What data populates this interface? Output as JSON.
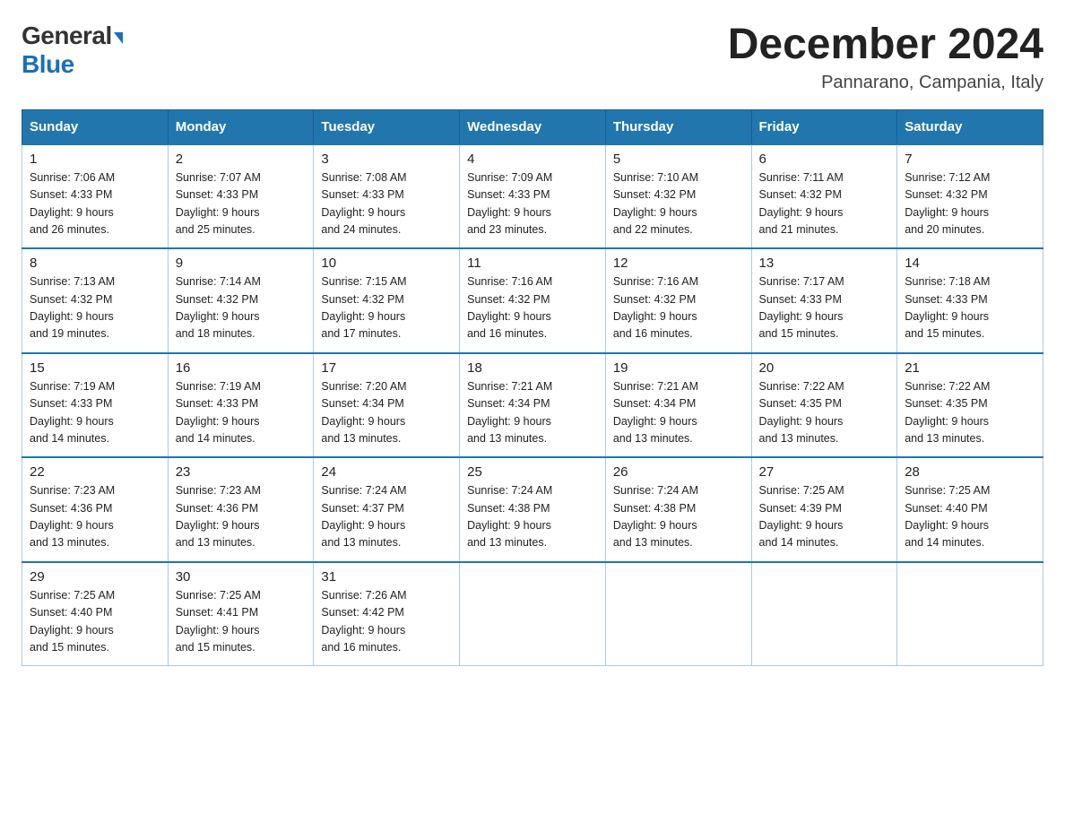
{
  "header": {
    "logo_general": "General",
    "logo_blue": "Blue",
    "month_title": "December 2024",
    "subtitle": "Pannarano, Campania, Italy"
  },
  "days_of_week": [
    "Sunday",
    "Monday",
    "Tuesday",
    "Wednesday",
    "Thursday",
    "Friday",
    "Saturday"
  ],
  "weeks": [
    [
      {
        "day": "1",
        "sunrise": "7:06 AM",
        "sunset": "4:33 PM",
        "daylight": "9 hours and 26 minutes."
      },
      {
        "day": "2",
        "sunrise": "7:07 AM",
        "sunset": "4:33 PM",
        "daylight": "9 hours and 25 minutes."
      },
      {
        "day": "3",
        "sunrise": "7:08 AM",
        "sunset": "4:33 PM",
        "daylight": "9 hours and 24 minutes."
      },
      {
        "day": "4",
        "sunrise": "7:09 AM",
        "sunset": "4:33 PM",
        "daylight": "9 hours and 23 minutes."
      },
      {
        "day": "5",
        "sunrise": "7:10 AM",
        "sunset": "4:32 PM",
        "daylight": "9 hours and 22 minutes."
      },
      {
        "day": "6",
        "sunrise": "7:11 AM",
        "sunset": "4:32 PM",
        "daylight": "9 hours and 21 minutes."
      },
      {
        "day": "7",
        "sunrise": "7:12 AM",
        "sunset": "4:32 PM",
        "daylight": "9 hours and 20 minutes."
      }
    ],
    [
      {
        "day": "8",
        "sunrise": "7:13 AM",
        "sunset": "4:32 PM",
        "daylight": "9 hours and 19 minutes."
      },
      {
        "day": "9",
        "sunrise": "7:14 AM",
        "sunset": "4:32 PM",
        "daylight": "9 hours and 18 minutes."
      },
      {
        "day": "10",
        "sunrise": "7:15 AM",
        "sunset": "4:32 PM",
        "daylight": "9 hours and 17 minutes."
      },
      {
        "day": "11",
        "sunrise": "7:16 AM",
        "sunset": "4:32 PM",
        "daylight": "9 hours and 16 minutes."
      },
      {
        "day": "12",
        "sunrise": "7:16 AM",
        "sunset": "4:32 PM",
        "daylight": "9 hours and 16 minutes."
      },
      {
        "day": "13",
        "sunrise": "7:17 AM",
        "sunset": "4:33 PM",
        "daylight": "9 hours and 15 minutes."
      },
      {
        "day": "14",
        "sunrise": "7:18 AM",
        "sunset": "4:33 PM",
        "daylight": "9 hours and 15 minutes."
      }
    ],
    [
      {
        "day": "15",
        "sunrise": "7:19 AM",
        "sunset": "4:33 PM",
        "daylight": "9 hours and 14 minutes."
      },
      {
        "day": "16",
        "sunrise": "7:19 AM",
        "sunset": "4:33 PM",
        "daylight": "9 hours and 14 minutes."
      },
      {
        "day": "17",
        "sunrise": "7:20 AM",
        "sunset": "4:34 PM",
        "daylight": "9 hours and 13 minutes."
      },
      {
        "day": "18",
        "sunrise": "7:21 AM",
        "sunset": "4:34 PM",
        "daylight": "9 hours and 13 minutes."
      },
      {
        "day": "19",
        "sunrise": "7:21 AM",
        "sunset": "4:34 PM",
        "daylight": "9 hours and 13 minutes."
      },
      {
        "day": "20",
        "sunrise": "7:22 AM",
        "sunset": "4:35 PM",
        "daylight": "9 hours and 13 minutes."
      },
      {
        "day": "21",
        "sunrise": "7:22 AM",
        "sunset": "4:35 PM",
        "daylight": "9 hours and 13 minutes."
      }
    ],
    [
      {
        "day": "22",
        "sunrise": "7:23 AM",
        "sunset": "4:36 PM",
        "daylight": "9 hours and 13 minutes."
      },
      {
        "day": "23",
        "sunrise": "7:23 AM",
        "sunset": "4:36 PM",
        "daylight": "9 hours and 13 minutes."
      },
      {
        "day": "24",
        "sunrise": "7:24 AM",
        "sunset": "4:37 PM",
        "daylight": "9 hours and 13 minutes."
      },
      {
        "day": "25",
        "sunrise": "7:24 AM",
        "sunset": "4:38 PM",
        "daylight": "9 hours and 13 minutes."
      },
      {
        "day": "26",
        "sunrise": "7:24 AM",
        "sunset": "4:38 PM",
        "daylight": "9 hours and 13 minutes."
      },
      {
        "day": "27",
        "sunrise": "7:25 AM",
        "sunset": "4:39 PM",
        "daylight": "9 hours and 14 minutes."
      },
      {
        "day": "28",
        "sunrise": "7:25 AM",
        "sunset": "4:40 PM",
        "daylight": "9 hours and 14 minutes."
      }
    ],
    [
      {
        "day": "29",
        "sunrise": "7:25 AM",
        "sunset": "4:40 PM",
        "daylight": "9 hours and 15 minutes."
      },
      {
        "day": "30",
        "sunrise": "7:25 AM",
        "sunset": "4:41 PM",
        "daylight": "9 hours and 15 minutes."
      },
      {
        "day": "31",
        "sunrise": "7:26 AM",
        "sunset": "4:42 PM",
        "daylight": "9 hours and 16 minutes."
      },
      null,
      null,
      null,
      null
    ]
  ],
  "labels": {
    "sunrise": "Sunrise:",
    "sunset": "Sunset:",
    "daylight": "Daylight:"
  }
}
